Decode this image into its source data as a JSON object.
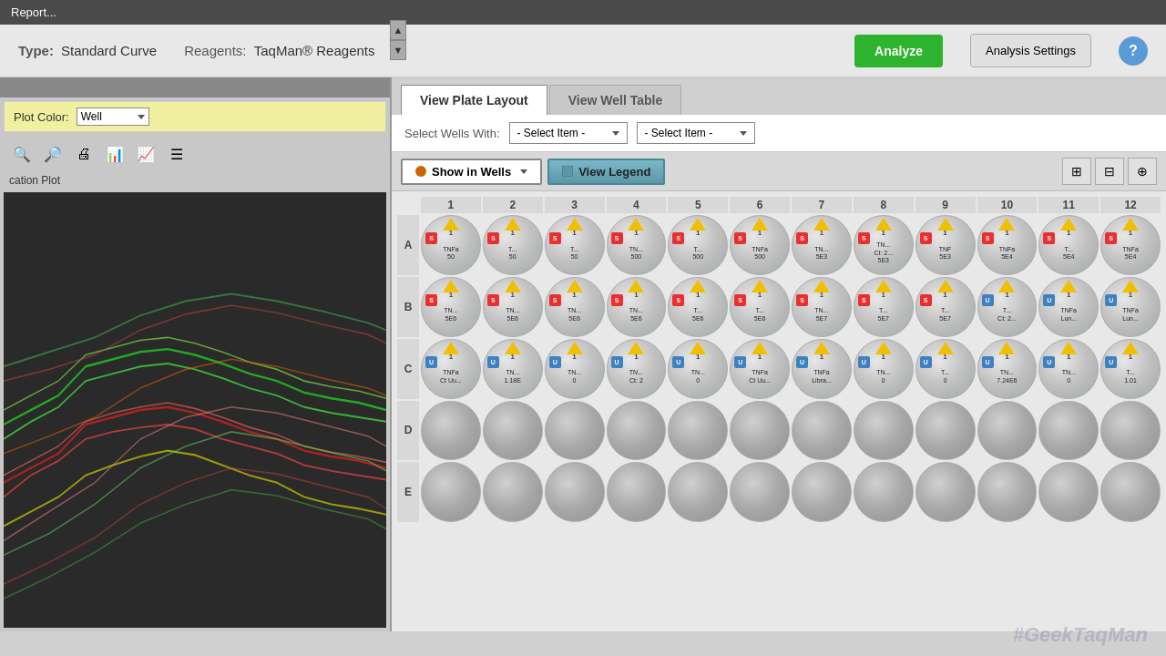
{
  "titleBar": {
    "text": "Report..."
  },
  "header": {
    "typeLabel": "Type:",
    "typeValue": "Standard Curve",
    "reagentsLabel": "Reagents:",
    "reagentsValue": "TaqMan® Reagents",
    "analyzeBtn": "Analyze",
    "analysisSettingsBtn": "Analysis Settings",
    "helpBtn": "?"
  },
  "leftPanel": {
    "plotColorLabel": "Plot Color:",
    "plotColorValue": "Well",
    "plotTitle": "cation Plot"
  },
  "tabs": [
    {
      "id": "plate",
      "label": "View Plate Layout",
      "active": true
    },
    {
      "id": "well",
      "label": "View Well Table",
      "active": false
    }
  ],
  "controls": {
    "selectWellsLabel": "Select Wells With:",
    "selectItem1": "- Select Item -",
    "selectItem2": "- Select Item -"
  },
  "wellsToolbar": {
    "showInWellsBtn": "Show in Wells",
    "viewLegendBtn": "View Legend"
  },
  "columnHeaders": [
    "1",
    "2",
    "3",
    "4",
    "5",
    "6",
    "7",
    "8",
    "9",
    "10",
    "11",
    "12"
  ],
  "rowHeaders": [
    "A",
    "B",
    "C",
    "D",
    "E"
  ],
  "watermark": "#GeekTaqMan",
  "wells": {
    "A": [
      {
        "type": "sample",
        "num": "1",
        "badge": "S",
        "text": "TNFa\n50"
      },
      {
        "type": "sample",
        "num": "1",
        "badge": "S",
        "text": "T...\n50"
      },
      {
        "type": "sample",
        "num": "1",
        "badge": "S",
        "text": "T...\n50"
      },
      {
        "type": "sample",
        "num": "1",
        "badge": "S",
        "text": "TN...\n500"
      },
      {
        "type": "sample",
        "num": "1",
        "badge": "S",
        "text": "T...\n500"
      },
      {
        "type": "sample",
        "num": "1",
        "badge": "S",
        "text": "TNFa\n500"
      },
      {
        "type": "sample",
        "num": "1",
        "badge": "S",
        "text": "TN...\n5E3"
      },
      {
        "type": "sample",
        "num": "1",
        "badge": "S",
        "text": "TN...\nCt: 2...\n5E3"
      },
      {
        "type": "sample",
        "num": "1",
        "badge": "S",
        "text": "TNF\n5E3"
      },
      {
        "type": "sample",
        "num": "1",
        "badge": "S",
        "text": "TNFa\n5E4"
      },
      {
        "type": "sample",
        "num": "1",
        "badge": "S",
        "text": "T...\n5E4"
      },
      {
        "type": "sample",
        "num": "1",
        "badge": "S",
        "text": "TNFa\n5E4"
      }
    ],
    "B": [
      {
        "type": "sample",
        "num": "1",
        "badge": "S",
        "text": "TN...\n5E6"
      },
      {
        "type": "sample",
        "num": "1",
        "badge": "S",
        "text": "TN...\n5E6"
      },
      {
        "type": "sample",
        "num": "1",
        "badge": "S",
        "text": "TN...\n5E6"
      },
      {
        "type": "sample",
        "num": "1",
        "badge": "S",
        "text": "TN...\n5E6"
      },
      {
        "type": "sample",
        "num": "1",
        "badge": "S",
        "text": "T...\n5E6"
      },
      {
        "type": "sample",
        "num": "1",
        "badge": "S",
        "text": "T...\n5E6"
      },
      {
        "type": "sample",
        "num": "1",
        "badge": "S",
        "text": "TN...\n5E7"
      },
      {
        "type": "sample",
        "num": "1",
        "badge": "S",
        "text": "T...\n5E7"
      },
      {
        "type": "sample",
        "num": "1",
        "badge": "S",
        "text": "T...\n5E7"
      },
      {
        "type": "unknown",
        "num": "1",
        "badge": "U",
        "text": "T...\nCt: 2..."
      },
      {
        "type": "unknown",
        "num": "1",
        "badge": "U",
        "text": "TNFa\nLun..."
      },
      {
        "type": "unknown",
        "num": "1",
        "badge": "U",
        "text": "TNFa\nLun..."
      }
    ],
    "C": [
      {
        "type": "unknown",
        "num": "1",
        "badge": "U",
        "text": "TNFa\nCt Uu..."
      },
      {
        "type": "unknown",
        "num": "1",
        "badge": "U",
        "text": "TN...\n1.18E"
      },
      {
        "type": "unknown",
        "num": "1",
        "badge": "U",
        "text": "TN...\n0"
      },
      {
        "type": "unknown",
        "num": "1",
        "badge": "U",
        "text": "TN...\nCt: 2"
      },
      {
        "type": "unknown",
        "num": "1",
        "badge": "U",
        "text": "TN...\n0"
      },
      {
        "type": "unknown",
        "num": "1",
        "badge": "U",
        "text": "TNFa\nCt Uu..."
      },
      {
        "type": "unknown",
        "num": "1",
        "badge": "U",
        "text": "TNFa\nLibra..."
      },
      {
        "type": "unknown",
        "num": "1",
        "badge": "U",
        "text": "TN...\n0"
      },
      {
        "type": "unknown",
        "num": "1",
        "badge": "U",
        "text": "T...\n0"
      },
      {
        "type": "unknown",
        "num": "1",
        "badge": "U",
        "text": "TN...\n7.24E6"
      },
      {
        "type": "unknown",
        "num": "1",
        "badge": "U",
        "text": "TN...\n0"
      },
      {
        "type": "unknown",
        "num": "1",
        "badge": "U",
        "text": "T...\n1.01"
      }
    ],
    "D": [
      {
        "type": "empty"
      },
      {
        "type": "empty"
      },
      {
        "type": "empty"
      },
      {
        "type": "empty"
      },
      {
        "type": "empty"
      },
      {
        "type": "empty"
      },
      {
        "type": "empty"
      },
      {
        "type": "empty"
      },
      {
        "type": "empty"
      },
      {
        "type": "empty"
      },
      {
        "type": "empty"
      },
      {
        "type": "empty"
      }
    ],
    "E": [
      {
        "type": "empty"
      },
      {
        "type": "empty"
      },
      {
        "type": "empty"
      },
      {
        "type": "empty"
      },
      {
        "type": "empty"
      },
      {
        "type": "empty"
      },
      {
        "type": "empty"
      },
      {
        "type": "empty"
      },
      {
        "type": "empty"
      },
      {
        "type": "empty"
      },
      {
        "type": "empty"
      },
      {
        "type": "empty"
      }
    ]
  }
}
